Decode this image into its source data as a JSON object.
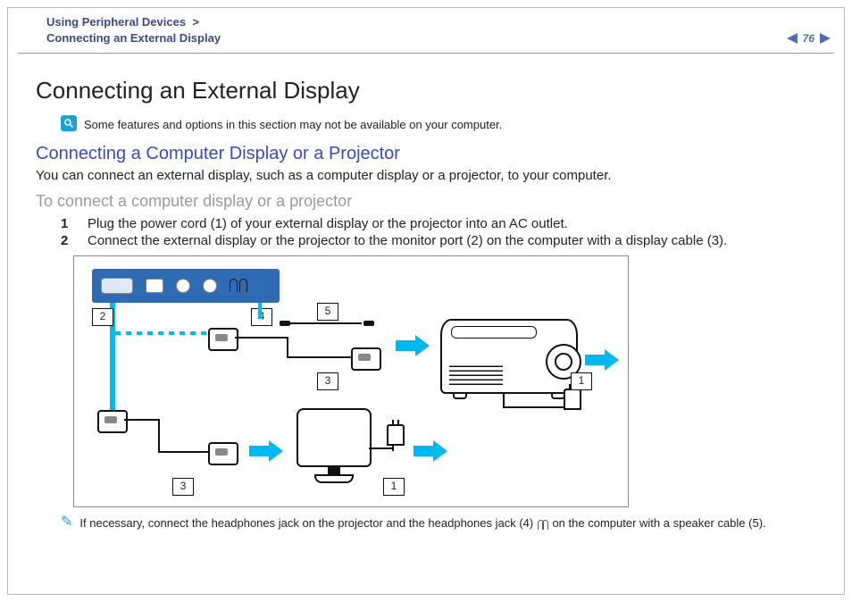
{
  "breadcrumb": {
    "section": "Using Peripheral Devices",
    "page": "Connecting an External Display"
  },
  "pager": {
    "page_number": "76"
  },
  "title": "Connecting an External Display",
  "note": "Some features and options in this section may not be available on your computer.",
  "heading_blue": "Connecting a Computer Display or a Projector",
  "intro": "You can connect an external display, such as a computer display or a projector, to your computer.",
  "heading_gray": "To connect a computer display or a projector",
  "steps": [
    "Plug the power cord (1) of your external display or the projector into an AC outlet.",
    "Connect the external display or the projector to the monitor port (2) on the computer with a display cable (3)."
  ],
  "footnote_pre": "If necessary, connect the headphones jack on the projector and the headphones jack (4) ",
  "footnote_post": " on the computer with a speaker cable (5).",
  "labels": {
    "l1": "1",
    "l2": "2",
    "l3": "3",
    "l4": "4",
    "l5": "5"
  }
}
